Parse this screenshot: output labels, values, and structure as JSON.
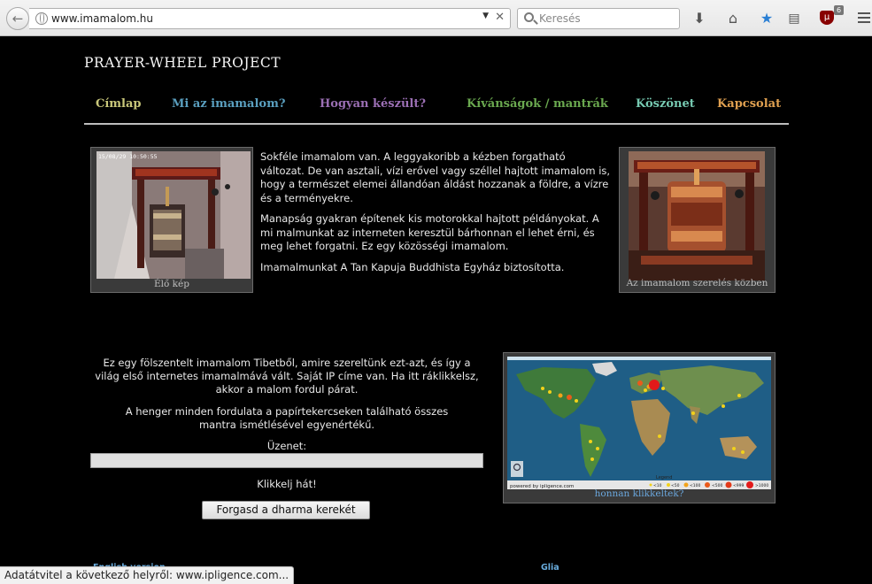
{
  "browser": {
    "url": "www.imamalom.hu",
    "search_placeholder": "Keresés",
    "ublock_count": "6",
    "status_text": "Adatátvitel a következő helyről: www.ipligence.com..."
  },
  "site": {
    "title": "PRAYER-WHEEL PROJECT",
    "nav": [
      {
        "label": "Címlap",
        "color": "#c9c77a"
      },
      {
        "label": "Mi az imamalom?",
        "color": "#5a9fbf"
      },
      {
        "label": "Hogyan készült?",
        "color": "#9b6fb4"
      },
      {
        "label": "Kívánságok / mantrák",
        "color": "#6aa84f"
      },
      {
        "label": "Köszönet",
        "color": "#76c9b1"
      },
      {
        "label": "Kapcsolat",
        "color": "#e0a050"
      }
    ],
    "live_photo": {
      "timestamp": "15/08/29 10:50:55",
      "caption": "Élő kép"
    },
    "install_photo": {
      "caption": "Az imamalom szerelés közben"
    },
    "intro_paragraphs": [
      "Sokféle imamalom van. A leggyakoribb a kézben forgatható változat. De van asztali, vízi erővel vagy széllel hajtott imamalom is, hogy a természet elemei állandóan áldást hozzanak a földre, a vízre és a terményekre.",
      "Manapság gyakran építenek kis motorokkal hajtott példányokat. A mi malmunkat az interneten keresztül bárhonnan el lehet érni, és meg lehet forgatni. Ez egy közösségi imamalom.",
      "Imamalmunkat A Tan Kapuja Buddhista Egyház biztosította."
    ],
    "wheel_paragraphs": [
      "Ez egy fölszentelt imamalom Tibetből, amire szereltünk ezt-azt, és így a világ első internetes imamalmává vált. Saját IP címe van. Ha itt ráklikkelsz, akkor a malom fordul párat.",
      "A henger minden fordulata a papírtekercseken található összes mantra ismétlésével egyenértékű."
    ],
    "message_label": "Üzenet:",
    "message_value": "",
    "click_text": "Klikkelj hát!",
    "spin_button": "Forgasd a dharma kerekét",
    "map": {
      "caption": "honnan klikkeltek?",
      "powered": "powered by ipligence.com",
      "legend_title": "Legend",
      "legend": [
        "<10",
        "<50",
        "<100",
        "<500",
        "<999",
        ">1000"
      ]
    },
    "footer": {
      "english": "English version",
      "glia": "Glia"
    }
  }
}
